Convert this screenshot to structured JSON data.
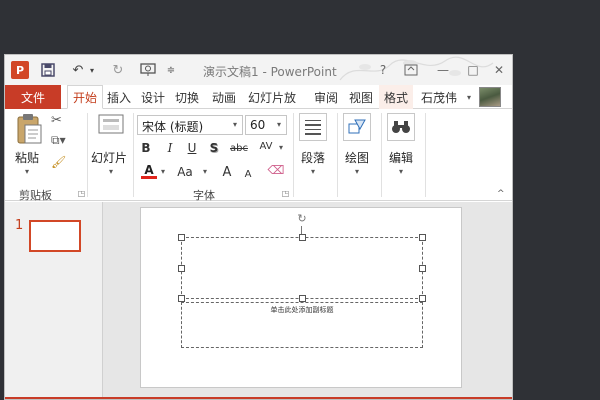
{
  "window": {
    "title": "演示文稿1 - PowerPoint",
    "app_icon_letter": "P",
    "brand_color": "#d24726",
    "file_tab_color": "#c83c27"
  },
  "quick_access": {
    "save_icon": "floppy-icon",
    "undo_icon": "undo-icon",
    "redo_icon": "redo-icon",
    "slideshow_icon": "slideshow-icon",
    "customize_icon": "customize-icon"
  },
  "tabs": {
    "file": "文件",
    "home": "开始",
    "insert": "插入",
    "design": "设计",
    "transitions": "切换",
    "animations": "动画",
    "slideshow": "幻灯片放",
    "review": "审阅",
    "view": "视图",
    "format": "格式"
  },
  "user": {
    "name": "石茂伟"
  },
  "ribbon": {
    "clipboard": {
      "paste": "粘贴",
      "label": "剪贴板"
    },
    "slides": {
      "new_slide": "幻灯片"
    },
    "font": {
      "name": "宋体 (标题)",
      "size": "60",
      "bold": "B",
      "italic": "I",
      "underline": "U",
      "shadow": "S",
      "strike": "abc",
      "spacing": "AV",
      "font_color": "A",
      "change_case": "Aa",
      "grow": "A",
      "shrink": "A",
      "label": "字体"
    },
    "paragraph": {
      "label": "段落"
    },
    "drawing": {
      "label": "绘图"
    },
    "editing": {
      "label": "编辑"
    }
  },
  "slides_pane": {
    "current_number": "1"
  },
  "slide": {
    "subtitle_placeholder": "单击此处添加副标题"
  }
}
